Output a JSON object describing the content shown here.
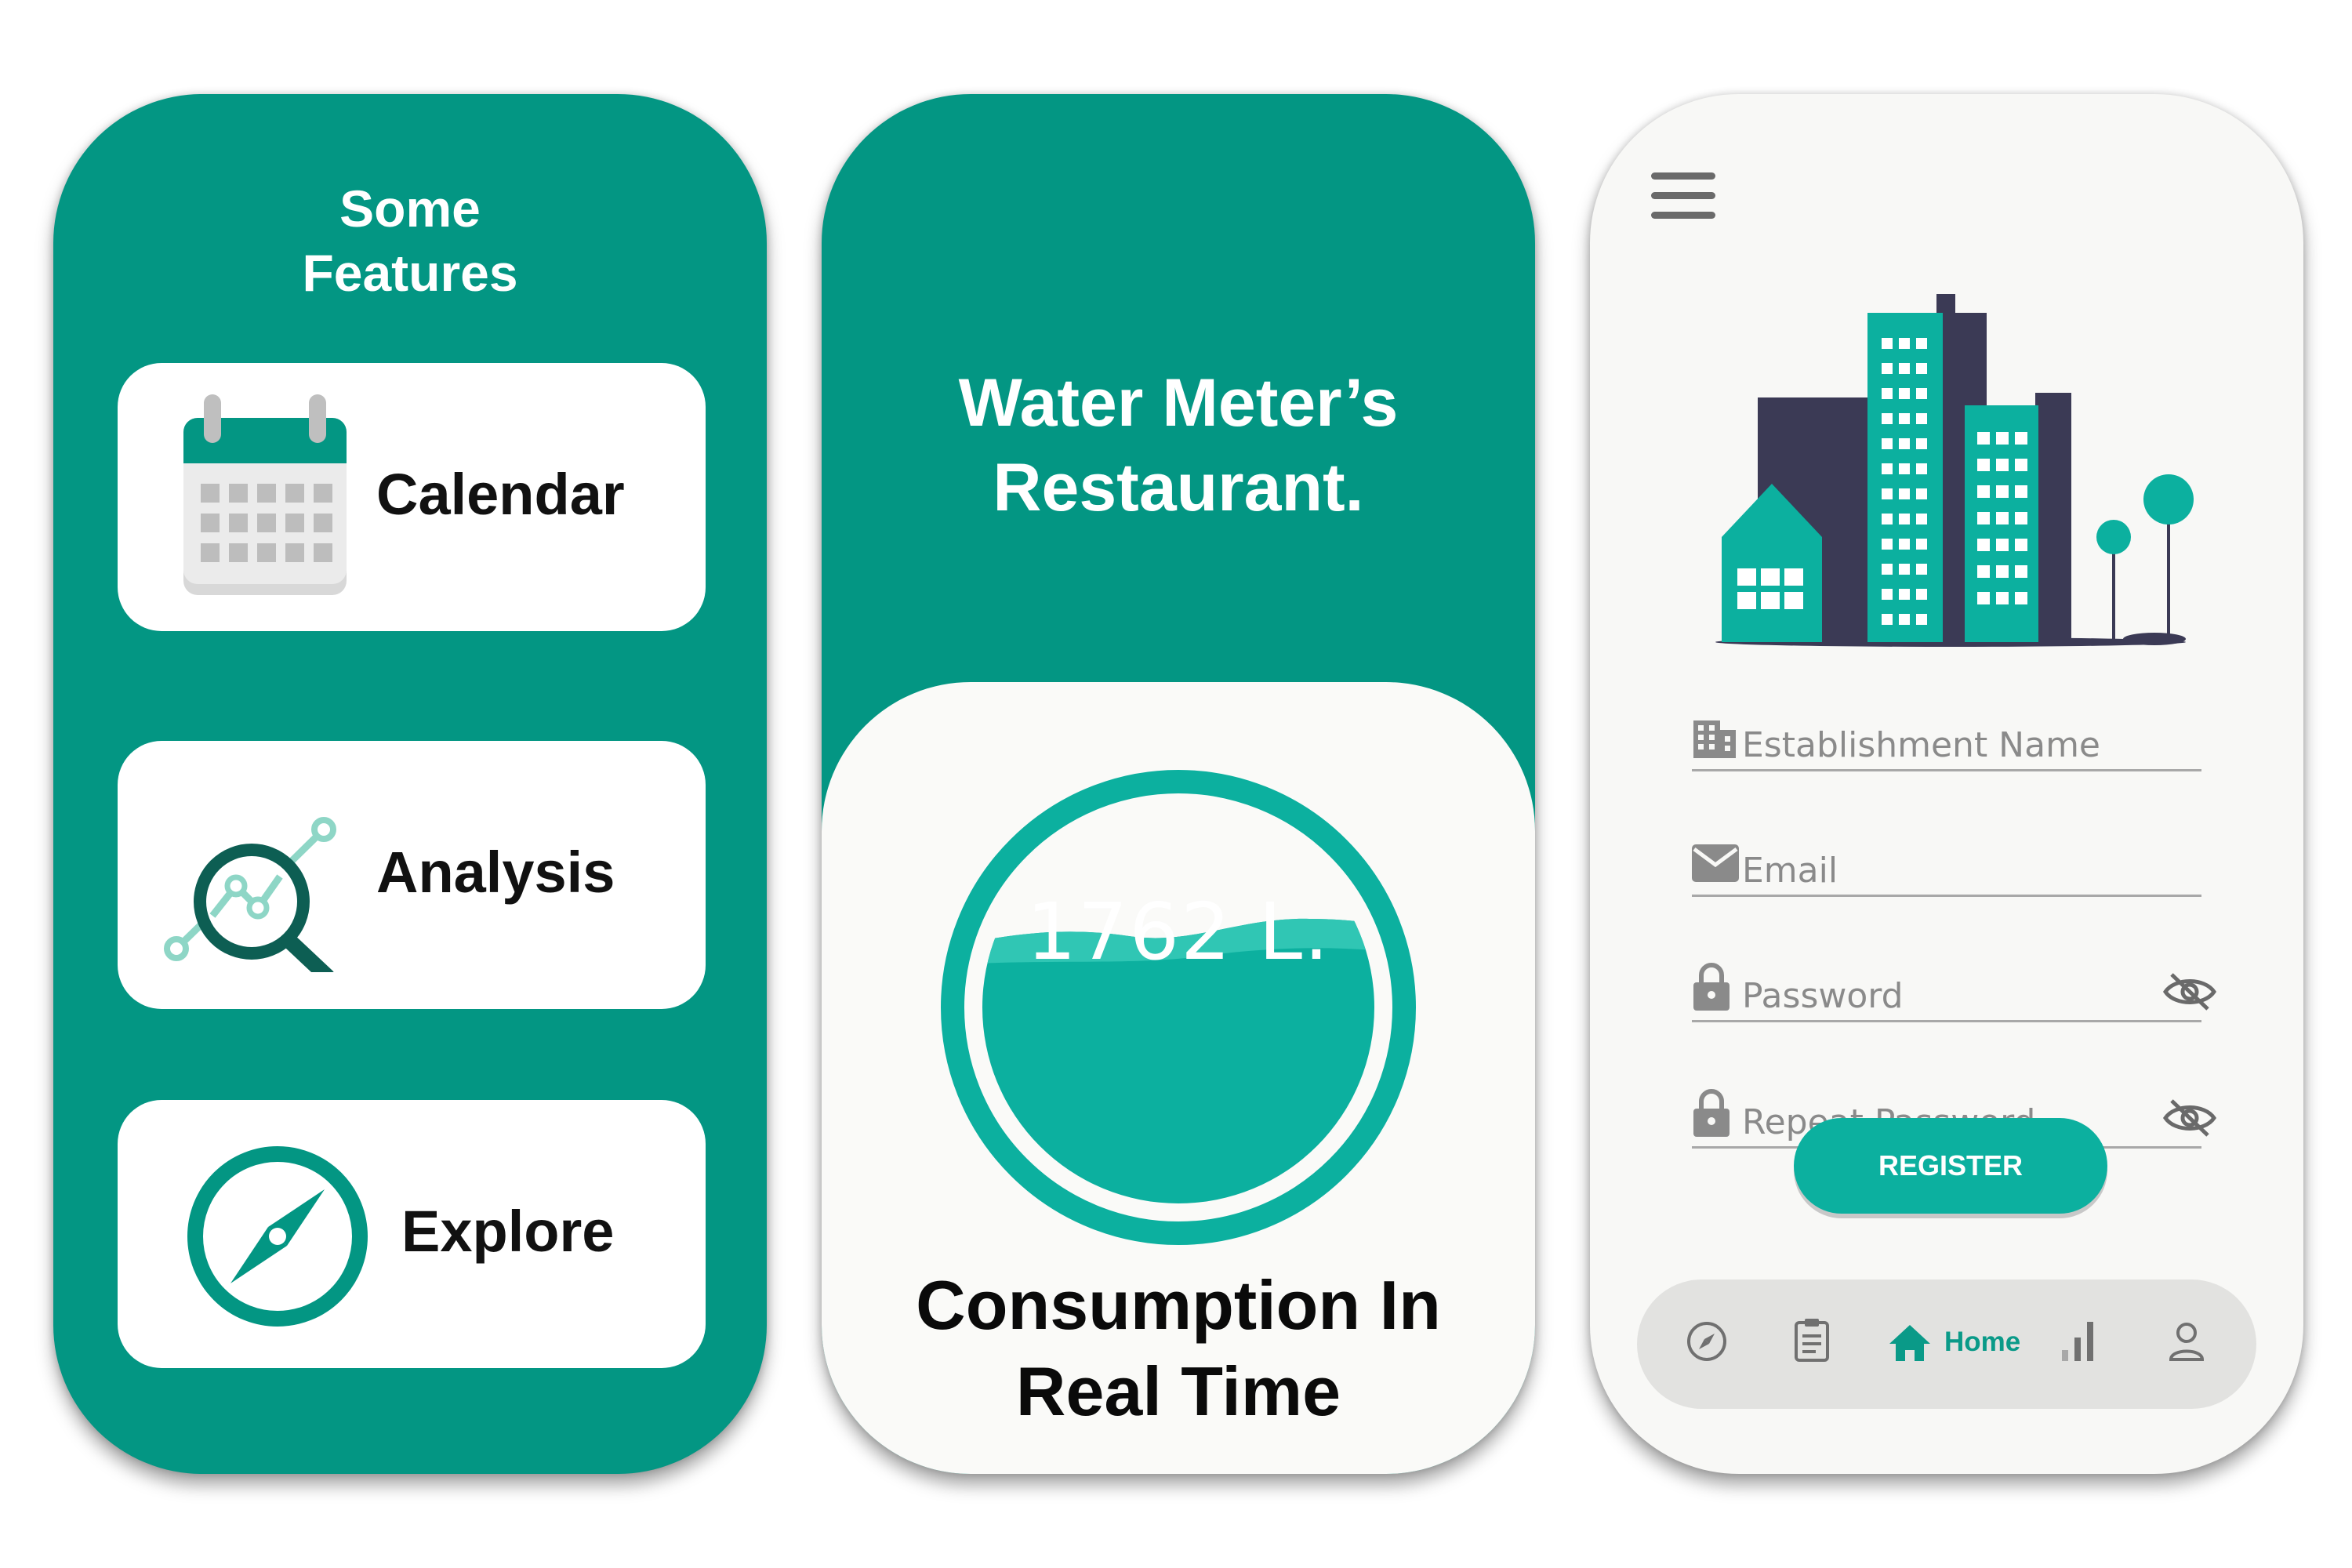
{
  "features_screen": {
    "title_line1": "Some",
    "title_line2": "Features",
    "items": [
      {
        "label": "Calendar",
        "icon": "calendar-icon"
      },
      {
        "label": "Analysis",
        "icon": "analysis-magnifier-icon"
      },
      {
        "label": "Explore",
        "icon": "compass-icon"
      }
    ]
  },
  "consumption_screen": {
    "title_line1": "Water Meter’s",
    "title_line2": "Restaurant.",
    "reading": "1762 L.",
    "caption_line1": "Consumption In",
    "caption_line2": "Real Time"
  },
  "register_screen": {
    "menu_icon": "hamburger-menu-icon",
    "illustration": "city-buildings-illustration",
    "fields": [
      {
        "placeholder": "Establishment Name",
        "icon": "building-icon"
      },
      {
        "placeholder": "Email",
        "icon": "envelope-icon"
      },
      {
        "placeholder": "Password",
        "icon": "lock-icon",
        "toggle": "eye-off-icon"
      },
      {
        "placeholder": "Repeat Password",
        "icon": "lock-icon",
        "toggle": "eye-off-icon"
      }
    ],
    "register_label": "REGISTER",
    "nav": {
      "items": [
        "compass-icon",
        "clipboard-icon",
        "home-icon",
        "bar-chart-icon",
        "user-icon"
      ],
      "active_label": "Home"
    }
  },
  "colors": {
    "teal_dark": "#039683",
    "teal_light": "#0cb09f",
    "navy": "#3b3a55",
    "card_white": "#ffffff",
    "screen_white": "#f8f8f6"
  }
}
